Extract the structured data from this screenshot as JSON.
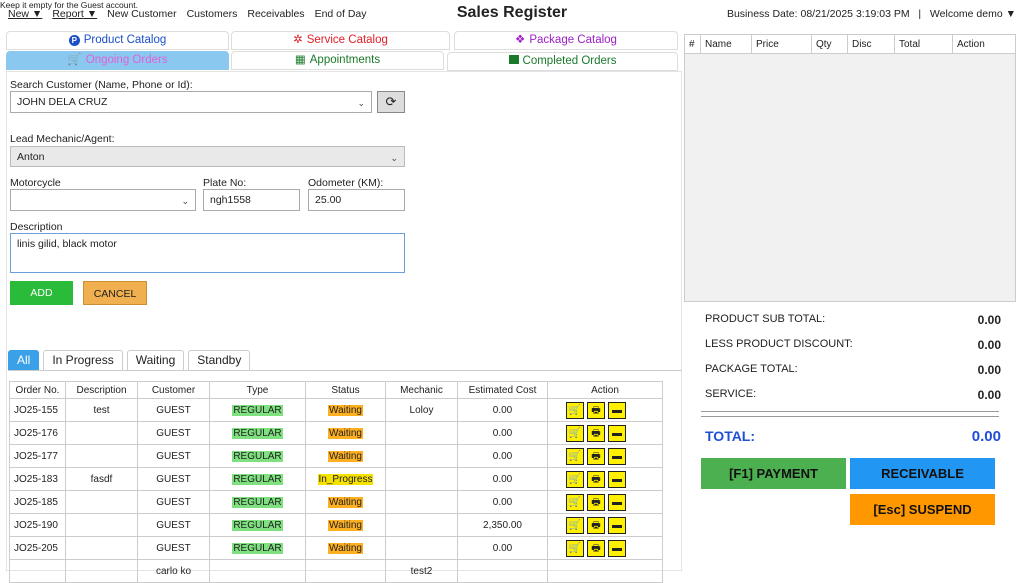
{
  "menu": {
    "new": "New",
    "report": "Report",
    "new_customer": "New Customer",
    "customers": "Customers",
    "receivables": "Receivables",
    "end_of_day": "End of Day"
  },
  "title": "Sales Register",
  "business_date": "Business Date: 08/21/2025 3:19:03 PM",
  "separator": "|",
  "welcome": "Welcome demo",
  "tabs": {
    "product": "Product Catalog",
    "service": "Service Catalog",
    "package": "Package Catalog",
    "ongoing": "Ongoing Orders",
    "appointments": "Appointments",
    "completed": "Completed Orders"
  },
  "form": {
    "search_label": "Search Customer (Name, Phone or Id):",
    "customer_value": "JOHN DELA CRUZ",
    "guest_hint": "Keep it empty for the Guest account.",
    "mechanic_label": "Lead Mechanic/Agent:",
    "mechanic_value": "Anton",
    "motorcycle_label": "Motorcycle",
    "motorcycle_value": "",
    "plate_label": "Plate No:",
    "plate_value": "ngh1558",
    "odometer_label": "Odometer (KM):",
    "odometer_value": "25.00",
    "description_label": "Description",
    "description_value": "linis gilid, black motor",
    "add": "ADD",
    "cancel": "CANCEL"
  },
  "subtabs": [
    "All",
    "In Progress",
    "Waiting",
    "Standby"
  ],
  "orders": {
    "headers": [
      "Order No.",
      "Description",
      "Customer",
      "Type",
      "Status",
      "Mechanic",
      "Estimated Cost",
      "Action"
    ],
    "rows": [
      {
        "no": "JO25-155",
        "desc": "test",
        "customer": "GUEST",
        "type": "REGULAR",
        "status": "Waiting",
        "mechanic": "Loloy",
        "cost": "0.00"
      },
      {
        "no": "JO25-176",
        "desc": "",
        "customer": "GUEST",
        "type": "REGULAR",
        "status": "Waiting",
        "mechanic": "",
        "cost": "0.00"
      },
      {
        "no": "JO25-177",
        "desc": "",
        "customer": "GUEST",
        "type": "REGULAR",
        "status": "Waiting",
        "mechanic": "",
        "cost": "0.00"
      },
      {
        "no": "JO25-183",
        "desc": "fasdf",
        "customer": "GUEST",
        "type": "REGULAR",
        "status": "In_Progress",
        "mechanic": "",
        "cost": "0.00"
      },
      {
        "no": "JO25-185",
        "desc": "",
        "customer": "GUEST",
        "type": "REGULAR",
        "status": "Waiting",
        "mechanic": "",
        "cost": "0.00"
      },
      {
        "no": "JO25-190",
        "desc": "",
        "customer": "GUEST",
        "type": "REGULAR",
        "status": "Waiting",
        "mechanic": "",
        "cost": "2,350.00"
      },
      {
        "no": "JO25-205",
        "desc": "",
        "customer": "GUEST",
        "type": "REGULAR",
        "status": "Waiting",
        "mechanic": "",
        "cost": "0.00"
      },
      {
        "no": "",
        "desc": "",
        "customer": "carlo ko",
        "type": "",
        "status": "",
        "mechanic": "test2",
        "cost": ""
      }
    ]
  },
  "cart": {
    "headers": [
      "#",
      "Name",
      "Price",
      "Qty",
      "Disc",
      "Total",
      "Action"
    ]
  },
  "summary": {
    "product_sub_label": "PRODUCT SUB TOTAL:",
    "product_sub": "0.00",
    "less_disc_label": "LESS PRODUCT DISCOUNT:",
    "less_disc": "0.00",
    "package_label": "PACKAGE TOTAL:",
    "package": "0.00",
    "service_label": "SERVICE:",
    "service": "0.00",
    "total_label": "TOTAL:",
    "total": "0.00"
  },
  "actions": {
    "payment": "[F1] PAYMENT",
    "receivable": "RECEIVABLE",
    "suspend": "[Esc] SUSPEND"
  },
  "colors": {
    "product": "#1a4fc9",
    "service": "#e0202a",
    "package": "#a020c8",
    "ongoing_bg": "#8bc8f0",
    "ongoing_text": "#e060d8",
    "green": "#1a7a2a",
    "add": "#2bbb3a",
    "cancel": "#f0b050",
    "payment": "#4caf50",
    "receivable": "#2196f3",
    "suspend": "#ff9800",
    "total": "#1f4fd8"
  }
}
